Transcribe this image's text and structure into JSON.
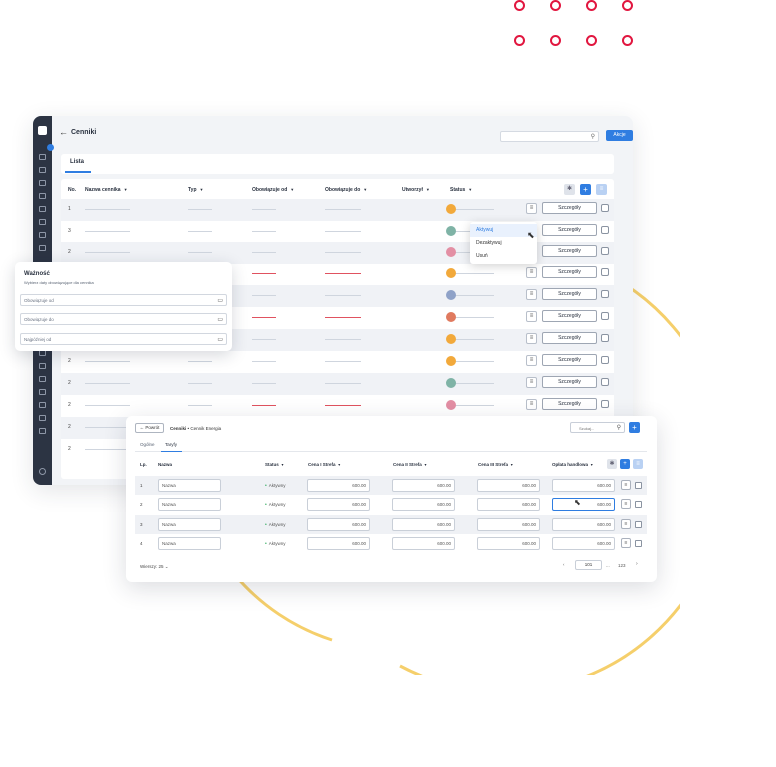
{
  "main": {
    "back_arrow": "←",
    "title": "Cenniki",
    "search_icon": "⚲",
    "akcje_label": "Akcje",
    "tab_lista": "Lista",
    "columns": [
      "No.",
      "Nazwa cennika",
      "Typ",
      "Obowiązuje od",
      "Obowiązuje do",
      "Utworzył",
      "Status"
    ],
    "row_numbers": [
      "1",
      "3",
      "2",
      "2",
      "2",
      "2",
      "2",
      "2",
      "2",
      "2",
      "2",
      "2"
    ],
    "details_label": "Szczegóły",
    "menu_icon": "≡",
    "plus": "+"
  },
  "dropdown": {
    "items": [
      "Aktywuj",
      "Dezaktywuj",
      "Usuń"
    ],
    "selected_index": 0
  },
  "popup": {
    "title": "Ważność",
    "subtitle": "Wybierz daty obowiązujące dla cennika",
    "fields": [
      "Obowiązuje od",
      "Obowiązuje do",
      "Najpóźniej od"
    ],
    "calendar_icon": "▭"
  },
  "win2": {
    "back_label": "← Powrót",
    "crumb_bold": "Cenniki",
    "crumb_rest": "• Cennik Energia",
    "search_placeholder": "Szukaj...",
    "plus": "+",
    "tabs": [
      "Ogólne",
      "Taryfy"
    ],
    "active_tab_index": 1,
    "columns": [
      "Lp.",
      "Nazwa",
      "Status",
      "Cena I Strefa",
      "Cena II Strefa",
      "Cena III Strefa",
      "Opłata handlowa"
    ],
    "rows": [
      {
        "no": "1",
        "name": "Nazwa",
        "status": "Aktywny",
        "c1": "600.00",
        "c2": "600.00",
        "c3": "600.00",
        "c4": "600.00"
      },
      {
        "no": "2",
        "name": "Nazwa",
        "status": "Aktywny",
        "c1": "600.00",
        "c2": "600.00",
        "c3": "600.00",
        "c4": "600.00"
      },
      {
        "no": "3",
        "name": "Nazwa",
        "status": "Aktywny",
        "c1": "600.00",
        "c2": "600.00",
        "c3": "600.00",
        "c4": "600.00"
      },
      {
        "no": "4",
        "name": "Nazwa",
        "status": "Aktywny",
        "c1": "600.00",
        "c2": "600.00",
        "c3": "600.00",
        "c4": "600.00"
      }
    ],
    "rows_per_page": "Wierszy: 25",
    "page_current": "101",
    "page_ellipsis": "...",
    "page_total": "123",
    "prev": "‹",
    "next": "›"
  },
  "colors": {
    "accent": "#2f7de1",
    "sidebar": "#2c3443",
    "dots": "#e1163f",
    "arc": "#f5cf6b",
    "active_status": "#2eaa5d",
    "date_line": "#e05260"
  }
}
